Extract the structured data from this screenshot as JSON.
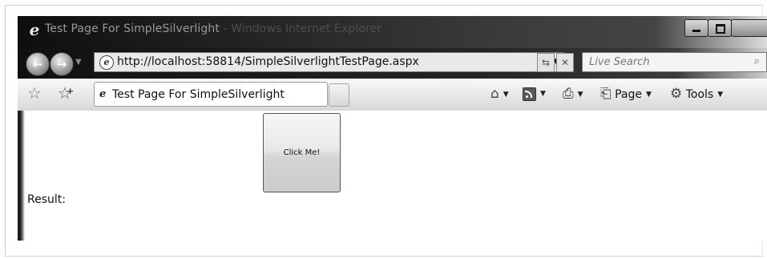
{
  "window": {
    "title": "Test Page For SimpleSilverlight",
    "title_suffix": " - Windows Internet Explorer"
  },
  "navbar": {
    "url": "http://localhost:58814/SimpleSilverlightTestPage.aspx",
    "search_placeholder": "Live Search"
  },
  "tabbar": {
    "tab_label": "Test Page For SimpleSilverlight",
    "tools": {
      "page_label": "Page",
      "tools_label": "Tools"
    }
  },
  "content": {
    "button_label": "Click Me!",
    "result_label": "Result:"
  },
  "colors": {
    "chrome_dark": "#1a1a1a",
    "tab_bg": "#ffffff",
    "button_face": "#e9e9e9"
  }
}
